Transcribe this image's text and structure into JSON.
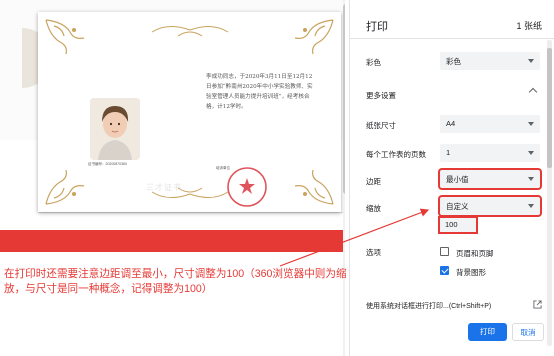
{
  "preview": {
    "certificate": {
      "body_text": "李成功同志，于2020年3月11日至12月12日参加“黔南州2020年中小学实验教师、实验室管理人员能力提升培训班”，经考核合格，计12学时。",
      "number": "证书编号：20200870360",
      "stamp_label": "培训单位",
      "watermark": "三才证书",
      "seal_text": "黔南州教育局"
    }
  },
  "panel": {
    "title": "打印",
    "sheets": "1 张纸",
    "color": {
      "label": "彩色",
      "value": "彩色"
    },
    "more_settings": "更多设置",
    "paper_size": {
      "label": "纸张尺寸",
      "value": "A4"
    },
    "pages_per_sheet": {
      "label": "每个工作表的页数",
      "value": "1"
    },
    "margins": {
      "label": "边距",
      "value": "最小值"
    },
    "scale": {
      "label": "缩放",
      "value": "自定义",
      "input_value": "100"
    },
    "options": {
      "label": "选项",
      "items": [
        {
          "label": "页眉和页脚",
          "checked": false
        },
        {
          "label": "背景图形",
          "checked": true
        }
      ]
    },
    "system_dialog": "使用系统对话框进行打印...(Ctrl+Shift+P)",
    "print_button": "打印",
    "cancel_button": "取消"
  },
  "annotation": "在打印时还需要注意边距调至最小，尺寸调整为100（360浏览器中则为缩放，与尺寸是同一种概念，记得调整为100）",
  "colors": {
    "accent": "#1a73e8",
    "highlight": "#e53935"
  }
}
